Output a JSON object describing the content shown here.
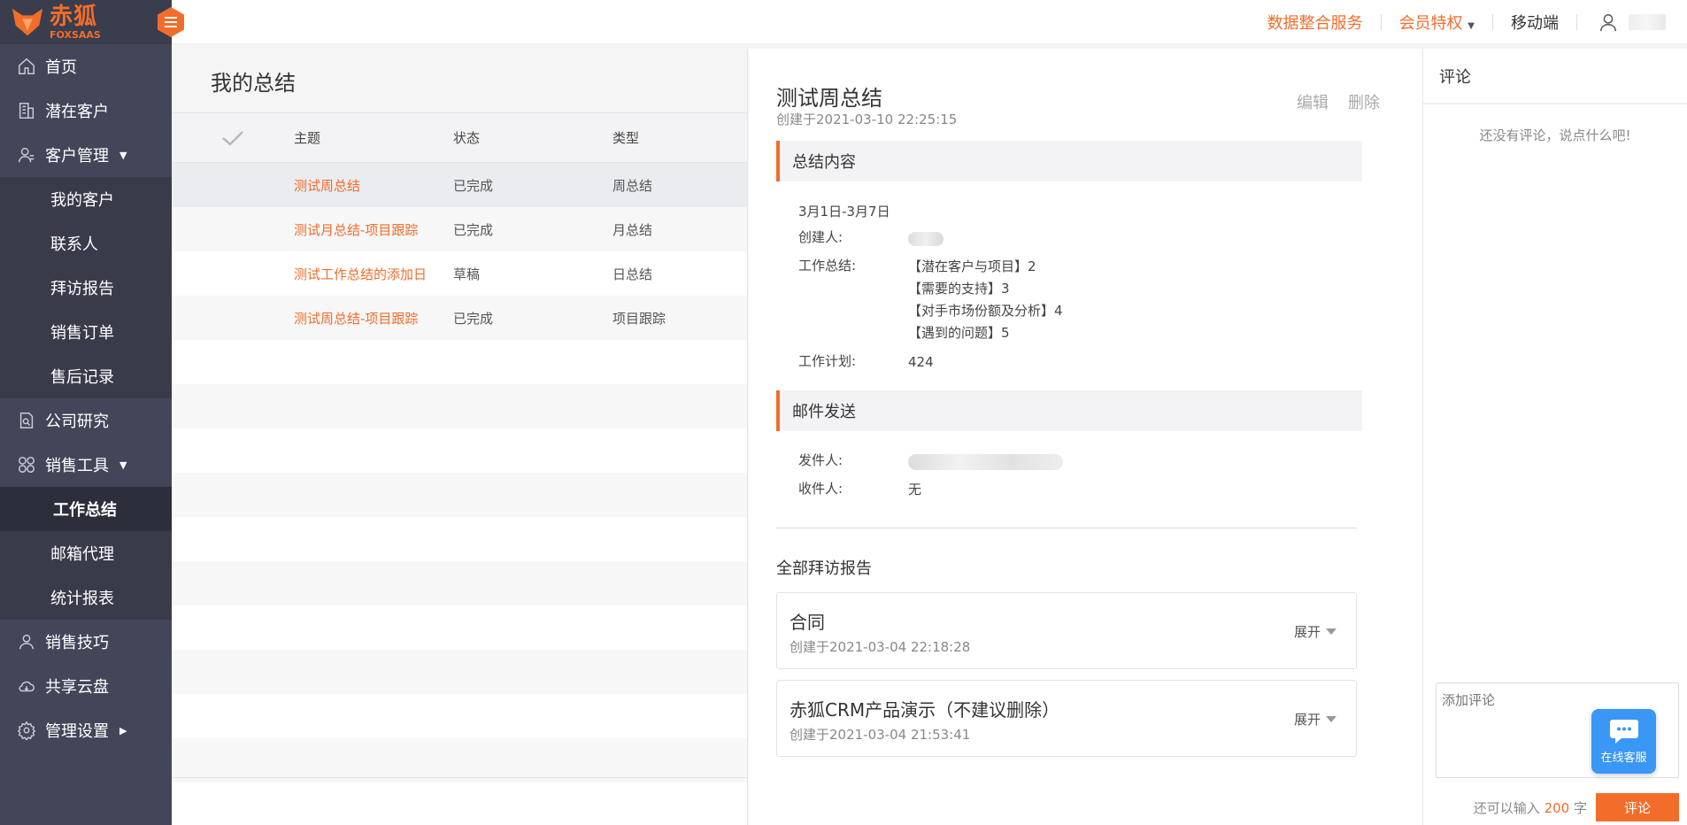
{
  "brand": {
    "name_cn": "赤狐",
    "name_en": "FOXSAAS",
    "accent": "#f26d2a",
    "sidebar_bg": "#434658"
  },
  "sidebar": {
    "items": [
      {
        "label": "首页",
        "icon": "home-icon"
      },
      {
        "label": "潜在客户",
        "icon": "building-icon"
      },
      {
        "label": "客户管理",
        "icon": "user-icon",
        "expanded": true
      },
      {
        "label": "我的客户"
      },
      {
        "label": "联系人"
      },
      {
        "label": "拜访报告"
      },
      {
        "label": "销售订单"
      },
      {
        "label": "售后记录"
      },
      {
        "label": "公司研究",
        "icon": "document-search-icon"
      },
      {
        "label": "销售工具",
        "icon": "grid-circles-icon",
        "expanded": true
      },
      {
        "label": "工作总结",
        "active": true
      },
      {
        "label": "邮箱代理"
      },
      {
        "label": "统计报表"
      },
      {
        "label": "销售技巧",
        "icon": "person-icon"
      },
      {
        "label": "共享云盘",
        "icon": "cloud-icon"
      },
      {
        "label": "管理设置",
        "icon": "settings-icon"
      }
    ]
  },
  "topbar": {
    "data_service": "数据整合服务",
    "membership": "会员特权",
    "mobile": "移动端"
  },
  "list": {
    "title": "我的总结",
    "columns": [
      "主题",
      "状态",
      "类型"
    ],
    "rows": [
      {
        "subject": "测试周总结",
        "status": "已完成",
        "type": "周总结"
      },
      {
        "subject": "测试月总结-项目跟踪",
        "status": "已完成",
        "type": "月总结"
      },
      {
        "subject": "测试工作总结的添加日",
        "status": "草稿",
        "type": "日总结"
      },
      {
        "subject": "测试周总结-项目跟踪",
        "status": "已完成",
        "type": "项目跟踪"
      }
    ]
  },
  "detail": {
    "title": "测试周总结",
    "created": "创建于2021-03-10 22:25:15",
    "edit": "编辑",
    "delete": "删除",
    "section_content": "总结内容",
    "period": "3月1日-3月7日",
    "creator_label": "创建人:",
    "work_summary_label": "工作总结:",
    "work_summary_lines": [
      "【潜在客户与项目】2",
      "【需要的支持】3",
      "【对手市场份额及分析】4",
      "【遇到的问题】5"
    ],
    "work_plan_label": "工作计划:",
    "work_plan": "424",
    "section_mail": "邮件发送",
    "sender_label": "发件人:",
    "recipient_label": "收件人:",
    "recipient": "无",
    "all_visits": "全部拜访报告",
    "visits": [
      {
        "title": "合同",
        "created": "创建于2021-03-04 22:18:28",
        "expand": "展开"
      },
      {
        "title": "赤狐CRM产品演示（不建议删除）",
        "created": "创建于2021-03-04 21:53:41",
        "expand": "展开"
      }
    ]
  },
  "comments": {
    "title": "评论",
    "empty": "还没有评论，说点什么吧!",
    "placeholder": "添加评论",
    "remain_prefix": "还可以输入",
    "remain_count": "200",
    "remain_suffix": "字",
    "submit": "评论"
  },
  "kefu": {
    "label": "在线客服"
  }
}
